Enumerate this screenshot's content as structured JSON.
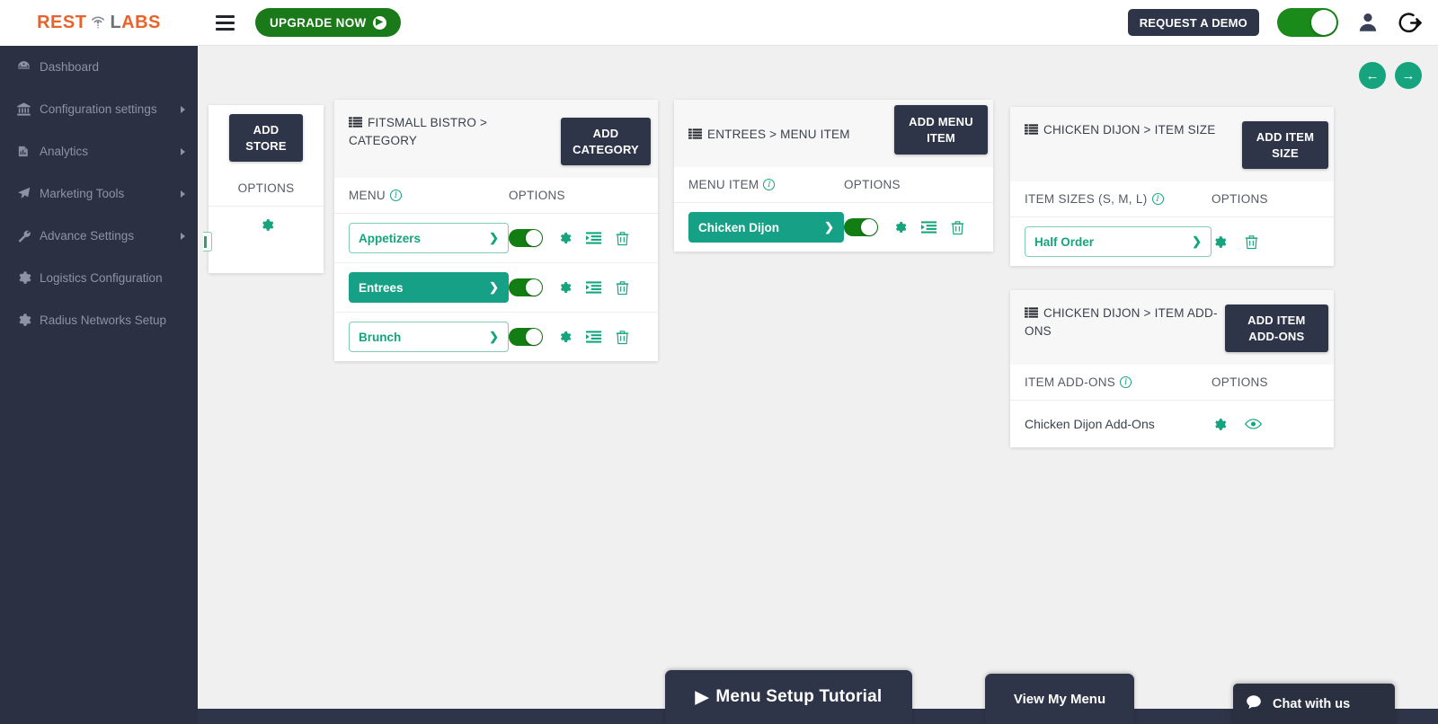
{
  "brand": {
    "logo_rest": "REST",
    "logo_l": "L",
    "logo_abs": "ABS",
    "accent_orange": "#e8622b",
    "accent_green": "#15a47e",
    "dark_navy": "#2f3548"
  },
  "sidebar": {
    "items": [
      {
        "label": "Dashboard",
        "icon": "dashboard-icon",
        "has_caret": false
      },
      {
        "label": "Configuration settings",
        "icon": "bank-icon",
        "has_caret": true
      },
      {
        "label": "Analytics",
        "icon": "analytics-icon",
        "has_caret": true
      },
      {
        "label": "Marketing Tools",
        "icon": "rocket-icon",
        "has_caret": true
      },
      {
        "label": "Advance Settings",
        "icon": "wrench-icon",
        "has_caret": true
      },
      {
        "label": "Logistics Configuration",
        "icon": "gear-icon",
        "has_caret": false
      },
      {
        "label": "Radius Networks Setup",
        "icon": "gear-icon",
        "has_caret": false
      }
    ]
  },
  "topbar": {
    "hamburger": "menu-icon",
    "upgrade_label": "UPGRADE NOW",
    "upgrade_arrow": "▶",
    "demo_label": "REQUEST A DEMO",
    "toggle_state": "on",
    "user_icon": "user-icon",
    "logout_icon": "logout-icon"
  },
  "pager": {
    "prev": "←",
    "next": "→"
  },
  "panels": {
    "store": {
      "add_button": "ADD STORE",
      "options_header": "OPTIONS",
      "rows": [
        {
          "gear": "gear-icon"
        }
      ]
    },
    "category": {
      "title": "FITSMALL BISTRO > CATEGORY",
      "add_button": "ADD CATEGORY",
      "col1": "MENU",
      "col2": "OPTIONS",
      "rows": [
        {
          "label": "Appetizers",
          "active": false,
          "toggle": "on"
        },
        {
          "label": "Entrees",
          "active": true,
          "toggle": "on"
        },
        {
          "label": "Brunch",
          "active": false,
          "toggle": "on"
        }
      ]
    },
    "menu_item": {
      "title": "ENTREES > MENU ITEM",
      "add_button": "ADD MENU ITEM",
      "col1": "MENU ITEM",
      "col2": "OPTIONS",
      "rows": [
        {
          "label": "Chicken Dijon",
          "active": true,
          "toggle": "on"
        }
      ]
    },
    "item_size": {
      "title": "CHICKEN DIJON > ITEM SIZE",
      "add_button": "ADD ITEM SIZE",
      "col1": "ITEM SIZES (S, M, L)",
      "col2": "OPTIONS",
      "rows": [
        {
          "label": "Half Order",
          "active": false
        }
      ]
    },
    "item_addons": {
      "title": "CHICKEN DIJON > ITEM ADD-ONS",
      "add_button": "ADD ITEM ADD-ONS",
      "col1": "ITEM ADD-ONS",
      "col2": "OPTIONS",
      "rows": [
        {
          "label": "Chicken Dijon Add-Ons"
        }
      ]
    }
  },
  "footer": {
    "tutorial_label": "Menu Setup Tutorial",
    "tutorial_icon": "play-icon",
    "view_menu_label": "View My Menu",
    "chat_label": "Chat with us",
    "chat_icon": "chat-bubble-icon"
  }
}
